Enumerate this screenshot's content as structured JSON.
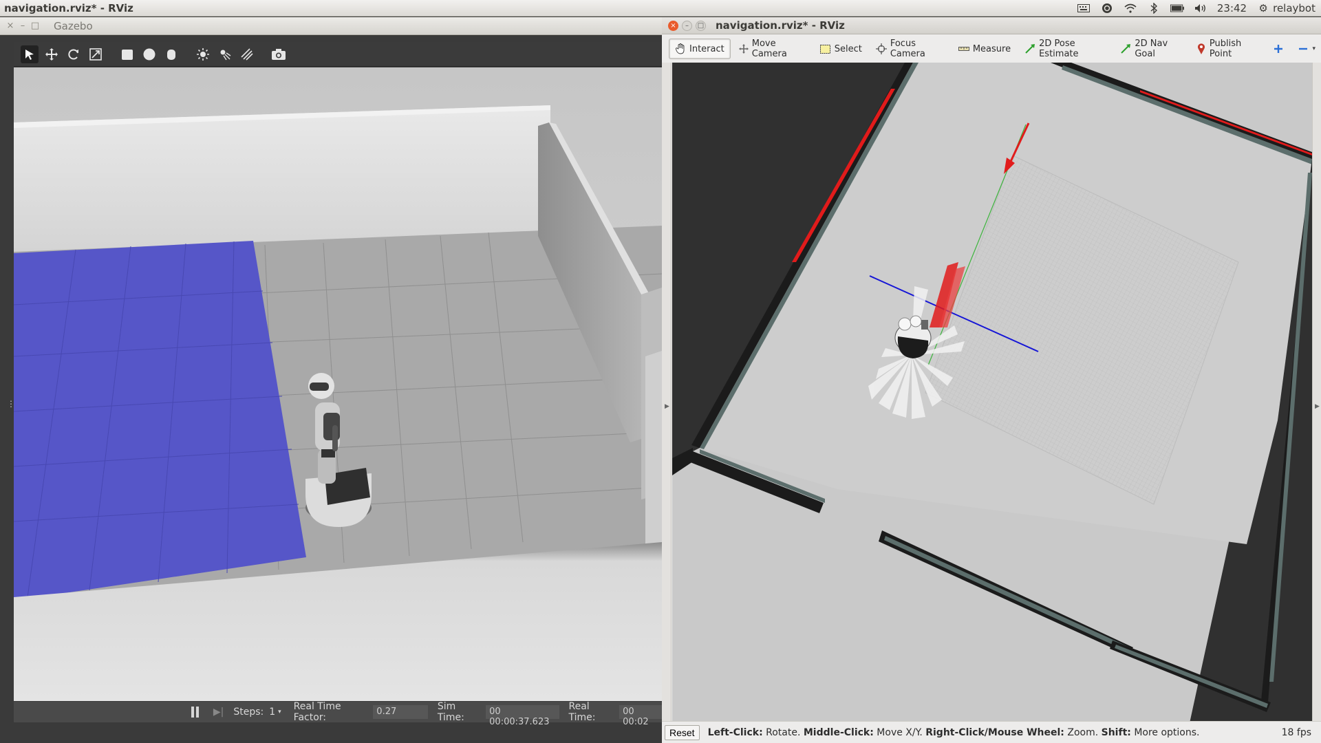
{
  "top_panel": {
    "title": "navigation.rviz* - RViz",
    "clock": "23:42",
    "user": "relaybot"
  },
  "gazebo": {
    "window_title": "Gazebo",
    "toolbar_icons": [
      "select-arrow-icon",
      "translate-icon",
      "rotate-icon",
      "scale-icon",
      "box-icon",
      "sphere-icon",
      "cylinder-icon",
      "point-light-icon",
      "spot-light-icon",
      "directional-light-icon",
      "screenshot-icon"
    ],
    "status": {
      "steps_label": "Steps:",
      "steps_value": "1",
      "rtf_label": "Real Time Factor:",
      "rtf_value": "0.27",
      "sim_time_label": "Sim Time:",
      "sim_time_value": "00 00:00:37.623",
      "real_time_label": "Real Time:",
      "real_time_value": "00 00:02"
    }
  },
  "rviz": {
    "window_title": "navigation.rviz* - RViz",
    "tools": [
      {
        "label": "Interact",
        "icon": "hand-icon"
      },
      {
        "label": "Move Camera",
        "icon": "move-camera-icon"
      },
      {
        "label": "Select",
        "icon": "select-box-icon"
      },
      {
        "label": "Focus Camera",
        "icon": "focus-camera-icon"
      },
      {
        "label": "Measure",
        "icon": "ruler-icon"
      },
      {
        "label": "2D Pose Estimate",
        "icon": "green-arrow-icon"
      },
      {
        "label": "2D Nav Goal",
        "icon": "green-arrow-icon"
      },
      {
        "label": "Publish Point",
        "icon": "map-pin-icon"
      }
    ],
    "status": {
      "reset_label": "Reset",
      "left_click": "Left-Click:",
      "left_click_action": "Rotate.",
      "middle_click": "Middle-Click:",
      "middle_click_action": "Move X/Y.",
      "right_click": "Right-Click/Mouse Wheel:",
      "right_click_action": "Zoom.",
      "shift": "Shift:",
      "shift_action": "More options.",
      "fps": "18 fps"
    }
  },
  "colors": {
    "rviz_accent_red": "#e11b1b",
    "gazebo_floor_blue": "#5656c8",
    "ubuntu_close": "#e95b2c"
  }
}
